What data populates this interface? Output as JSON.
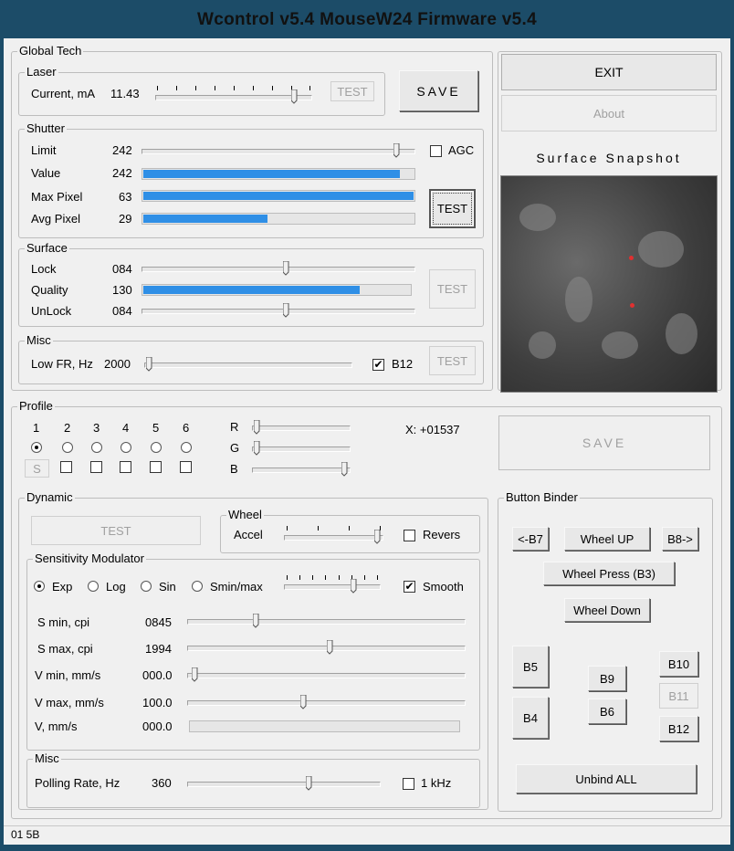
{
  "window": {
    "title": "Wcontrol v5.4  MouseW24  Firmware v5.4"
  },
  "global_tech": {
    "label": "Global Tech",
    "laser": {
      "label": "Laser",
      "current_label": "Current, mA",
      "current_value": "11.43",
      "test_label": "TEST",
      "slider_level": 0.93
    },
    "save_label": "SAVE",
    "shutter": {
      "label": "Shutter",
      "limit_label": "Limit",
      "limit_value": "242",
      "limit_level": 0.95,
      "agc_label": "AGC",
      "agc_checked": false,
      "value_label": "Value",
      "value_value": "242",
      "value_level": 0.95,
      "maxpixel_label": "Max Pixel",
      "maxpixel_value": "63",
      "maxpixel_level": 1.0,
      "avgpixel_label": "Avg Pixel",
      "avgpixel_value": "29",
      "avgpixel_level": 0.46,
      "test_label": "TEST"
    },
    "surface": {
      "label": "Surface",
      "lock_label": "Lock",
      "lock_value": "084",
      "lock_level": 0.53,
      "quality_label": "Quality",
      "quality_value": "130",
      "quality_level": 0.81,
      "unlock_label": "UnLock",
      "unlock_value": "084",
      "unlock_level": 0.53,
      "test_label": "TEST"
    },
    "misc": {
      "label": "Misc",
      "lowfr_label": "Low FR, Hz",
      "lowfr_value": "2000",
      "lowfr_level": 0.0,
      "b12_label": "B12",
      "b12_checked": true,
      "test_label": "TEST"
    }
  },
  "right_panel": {
    "exit_label": "EXIT",
    "about_label": "About",
    "snapshot_title": "Surface Snapshot"
  },
  "profile": {
    "label": "Profile",
    "numbers": [
      "1",
      "2",
      "3",
      "4",
      "5",
      "6"
    ],
    "selected_index": 0,
    "s_label": "S",
    "r_label": "R",
    "g_label": "G",
    "b_label": "B",
    "r_level": 0.0,
    "g_level": 0.0,
    "b_level": 1.0,
    "x_readout": "X: +01537",
    "save_label": "SAVE"
  },
  "dynamic": {
    "label": "Dynamic",
    "test_label": "TEST",
    "wheel": {
      "label": "Wheel",
      "accel_label": "Accel",
      "accel_level": 1.0,
      "revers_label": "Revers",
      "revers_checked": false
    },
    "sensitivity": {
      "label": "Sensitivity Modulator",
      "modes": [
        "Exp",
        "Log",
        "Sin",
        "Smin/max"
      ],
      "selected_mode": 0,
      "mode_level": 0.75,
      "smooth_label": "Smooth",
      "smooth_checked": true,
      "rows": [
        {
          "label": "S min, cpi",
          "value": "0845",
          "level": 0.23
        },
        {
          "label": "S max, cpi",
          "value": "1994",
          "level": 0.51
        },
        {
          "label": "V min, mm/s",
          "value": "000.0",
          "level": 0.0
        },
        {
          "label": "V max, mm/s",
          "value": "100.0",
          "level": 0.41
        },
        {
          "label": "V, mm/s",
          "value": "000.0",
          "level": 0.0
        }
      ]
    },
    "misc": {
      "label": "Misc",
      "polling_label": "Polling Rate, Hz",
      "polling_value": "360",
      "polling_level": 0.64,
      "khz_label": "1 kHz",
      "khz_checked": false
    }
  },
  "button_binder": {
    "label": "Button Binder",
    "b7_label": "<-B7",
    "wheel_up_label": "Wheel UP",
    "b8_label": "B8->",
    "wheel_press_label": "Wheel Press (B3)",
    "wheel_down_label": "Wheel Down",
    "b5_label": "B5",
    "b4_label": "B4",
    "b9_label": "B9",
    "b6_label": "B6",
    "b10_label": "B10",
    "b11_label": "B11",
    "b12_label": "B12",
    "unbind_label": "Unbind ALL"
  },
  "status": {
    "text": "01 5B"
  }
}
